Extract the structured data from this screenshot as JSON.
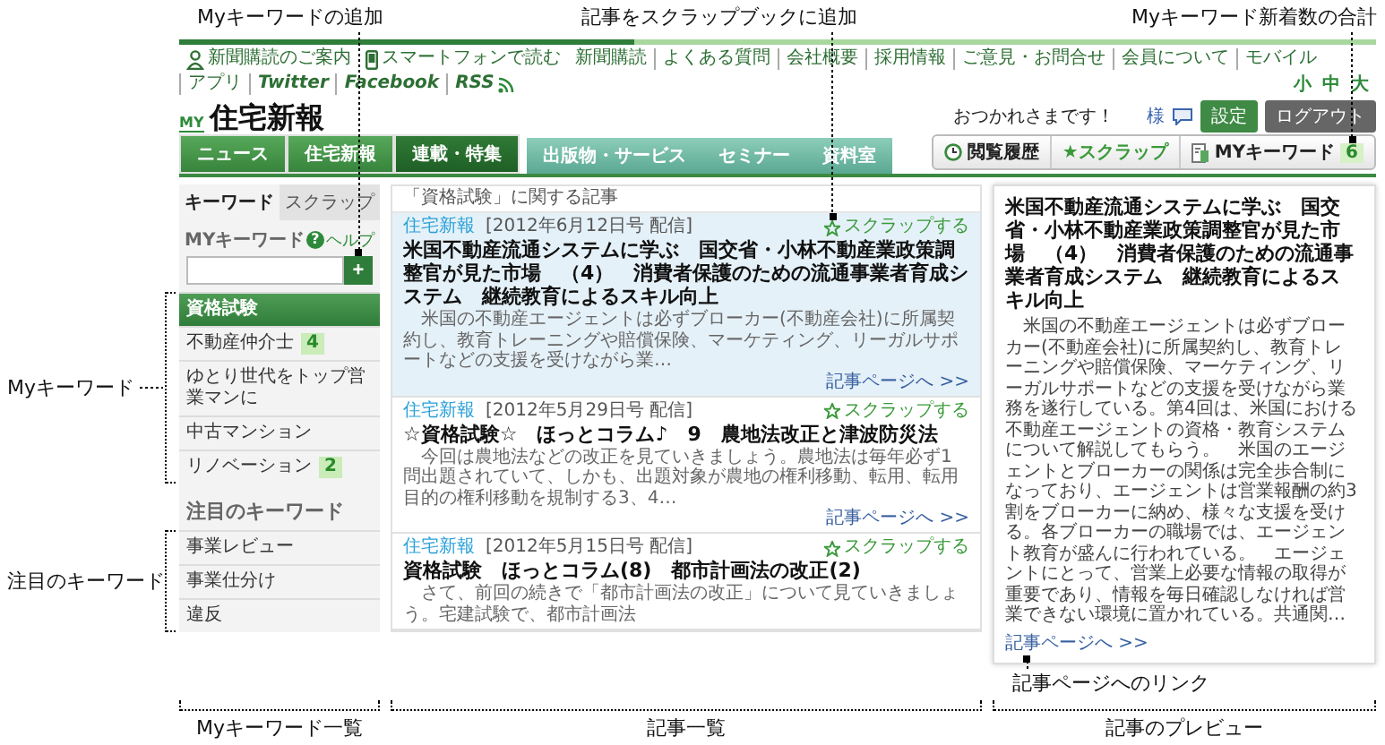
{
  "header": {
    "top_links": [
      {
        "kind": "guide",
        "text": "新聞購読のご案内"
      },
      {
        "kind": "mobile",
        "text": "スマートフォンで読む"
      },
      {
        "kind": "link",
        "text": "新聞購読"
      },
      {
        "kind": "link",
        "text": "よくある質問"
      },
      {
        "kind": "link",
        "text": "会社概要"
      },
      {
        "kind": "link",
        "text": "採用情報"
      },
      {
        "kind": "link",
        "text": "ご意見・お問合せ"
      },
      {
        "kind": "link",
        "text": "会員について"
      },
      {
        "kind": "link",
        "text": "モバイル"
      },
      {
        "kind": "link",
        "text": "アプリ"
      },
      {
        "kind": "social",
        "text": "Twitter"
      },
      {
        "kind": "social",
        "text": "Facebook"
      },
      {
        "kind": "rss",
        "text": "RSS"
      }
    ],
    "font_sizes": [
      "小",
      "中",
      "大"
    ],
    "logo": {
      "prefix": "MY",
      "name": "住宅新報"
    },
    "greeting": "おつかれさまです！",
    "user_suffix": "様",
    "buttons": [
      {
        "kind": "settings",
        "label": "設定"
      },
      {
        "kind": "logout",
        "label": "ログアウト"
      }
    ],
    "nav": [
      {
        "kind": "main",
        "label": "ニュース",
        "selected": false
      },
      {
        "kind": "main",
        "label": "住宅新報",
        "selected": false
      },
      {
        "kind": "main",
        "label": "連載・特集",
        "selected": true
      },
      {
        "kind": "sub",
        "label": "出版物・サービス",
        "selected": false
      },
      {
        "kind": "sub",
        "label": "セミナー",
        "selected": false
      },
      {
        "kind": "sub",
        "label": "資料室",
        "selected": false
      }
    ],
    "tools": [
      {
        "kind": "history",
        "label": "閲覧履歴"
      },
      {
        "kind": "scrap",
        "label": "★スクラップ"
      },
      {
        "kind": "keyword",
        "label": "MYキーワード",
        "count": "6",
        "callout": "Myキーワード新着数の合計"
      }
    ]
  },
  "sidebar": {
    "callout": "Myキーワード一覧",
    "tabs": [
      {
        "label": "キーワード",
        "selected": true
      },
      {
        "label": "スクラップ",
        "selected": false
      }
    ],
    "help": {
      "icon": "?",
      "label": "ヘルプ"
    },
    "my_keywords": {
      "title": "MYキーワード",
      "callout": "Myキーワード",
      "add_button": {
        "label": "+",
        "callout": "Myキーワードの追加"
      },
      "items": [
        {
          "label": "資格試験",
          "selected": true
        },
        {
          "label": "不動産仲介士",
          "count": "4",
          "selected": false
        },
        {
          "label": "ゆとり世代をトップ営業マンに",
          "selected": false
        },
        {
          "label": "中古マンション",
          "selected": false
        },
        {
          "label": "リノベーション",
          "count": "2",
          "selected": false
        }
      ]
    },
    "featured": {
      "title": "注目のキーワード",
      "callout": "注目のキーワード",
      "items": [
        {
          "label": "事業レビュー"
        },
        {
          "label": "事業仕分け"
        },
        {
          "label": "違反"
        }
      ]
    }
  },
  "articles": {
    "callout": "記事一覧",
    "heading": "「資格試験」に関する記事",
    "items": [
      {
        "selected": true,
        "source": "住宅新報",
        "date": "[2012年6月12日号 配信]",
        "scrap": "スクラップする",
        "scrap_callout": "記事をスクラップブックに追加",
        "title": "米国不動産流通システムに学ぶ　国交省・小林不動産業政策調整官が見た市場　（4）　消費者保護のための流通事業者育成システム　継続教育によるスキル向上",
        "excerpt": "米国の不動産エージェントは必ずブローカー(不動産会社)に所属契約し、教育トレーニングや賠償保険、マーケティング、リーガルサポートなどの支援を受けながら業…",
        "link": "記事ページへ >>"
      },
      {
        "selected": false,
        "source": "住宅新報",
        "date": "[2012年5月29日号 配信]",
        "scrap": "スクラップする",
        "title": "☆資格試験☆　ほっとコラム♪　9　農地法改正と津波防災法",
        "excerpt": "今回は農地法などの改正を見ていきましょう。農地法は毎年必ず1問出題されていて、しかも、出題対象が農地の権利移動、転用、転用目的の権利移動を規制する3、4…",
        "link": "記事ページへ >>"
      },
      {
        "selected": false,
        "source": "住宅新報",
        "date": "[2012年5月15日号 配信]",
        "scrap": "スクラップする",
        "title": "資格試験　ほっとコラム(8)　都市計画法の改正(2)",
        "excerpt": "さて、前回の続きで「都市計画法の改正」について見ていきましょう。宅建試験で、都市計画法"
      }
    ]
  },
  "preview": {
    "callout": "記事のプレビュー",
    "title": "米国不動産流通システムに学ぶ　国交省・小林不動産業政策調整官が見た市場　（4）　消費者保護のための流通事業者育成システム　継続教育によるスキル向上",
    "body": "米国の不動産エージェントは必ずブローカー(不動産会社)に所属契約し、教育トレーニングや賠償保険、マーケティング、リーガルサポートなどの支援を受けながら業務を遂行している。第4回は、米国における不動産エージェントの資格・教育システムについて解説してもらう。　米国のエージェントとブローカーの関係は完全歩合制になっており、エージェントは営業報酬の約3割をブローカーに納め、様々な支援を受ける。各ブローカーの職場では、エージェント教育が盛んに行われている。　エージェントにとって、営業上必要な情報の取得が重要であり、情報を毎日確認しなければ営業できない環境に置かれている。共通関…",
    "link": "記事ページへ >>",
    "link_callout": "記事ページへのリンク"
  }
}
